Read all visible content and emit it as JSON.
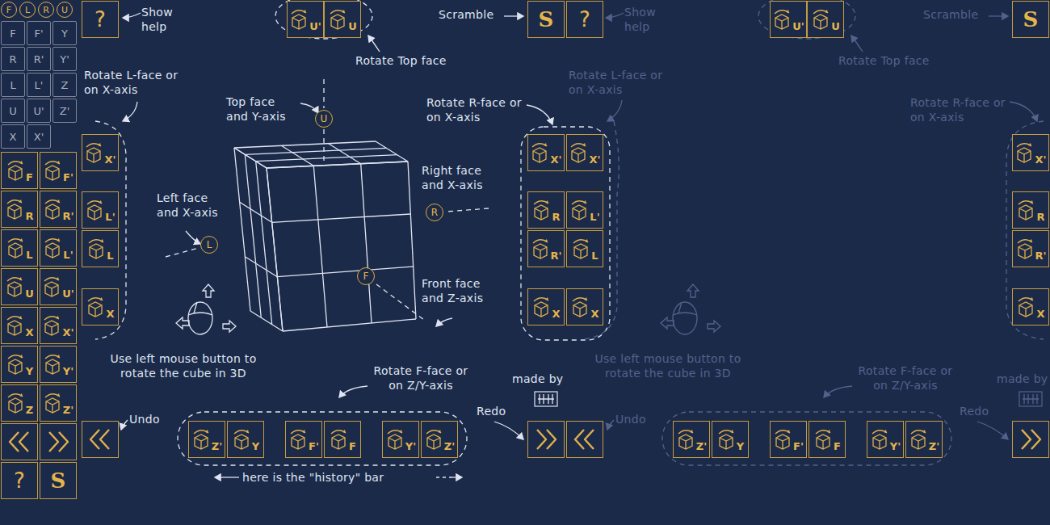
{
  "sidebar": {
    "face_toggles": [
      "F",
      "L",
      "R",
      "U"
    ],
    "small_buttons": [
      {
        "label": "F",
        "disabled": true
      },
      {
        "label": "F'",
        "disabled": true
      },
      {
        "label": "Y",
        "disabled": true
      },
      {
        "label": "R",
        "disabled": true
      },
      {
        "label": "R'",
        "disabled": true
      },
      {
        "label": "Y'",
        "disabled": true
      },
      {
        "label": "L",
        "disabled": true
      },
      {
        "label": "L'",
        "disabled": true
      },
      {
        "label": "Z",
        "disabled": true
      },
      {
        "label": "U",
        "disabled": true
      },
      {
        "label": "U'",
        "disabled": true
      },
      {
        "label": "Z'",
        "disabled": true
      },
      {
        "label": "X",
        "disabled": true
      },
      {
        "label": "X'",
        "disabled": true
      }
    ],
    "buttons": [
      {
        "kind": "move",
        "label": "F"
      },
      {
        "kind": "move",
        "label": "F'"
      },
      {
        "kind": "move",
        "label": "R"
      },
      {
        "kind": "move",
        "label": "R'"
      },
      {
        "kind": "move",
        "label": "L"
      },
      {
        "kind": "move",
        "label": "L'"
      },
      {
        "kind": "move",
        "label": "U"
      },
      {
        "kind": "move",
        "label": "U'"
      },
      {
        "kind": "move",
        "label": "X"
      },
      {
        "kind": "move",
        "label": "X'"
      },
      {
        "kind": "move",
        "label": "Y"
      },
      {
        "kind": "move",
        "label": "Y'"
      },
      {
        "kind": "move",
        "label": "Z"
      },
      {
        "kind": "move",
        "label": "Z'"
      },
      {
        "kind": "undo"
      },
      {
        "kind": "redo"
      },
      {
        "kind": "help",
        "label": "?"
      },
      {
        "kind": "scramble",
        "label": "S"
      }
    ]
  },
  "help_overlay": {
    "notes": [
      {
        "text": "Show help",
        "faded": false
      },
      {
        "text": "Scramble",
        "faded": false
      },
      {
        "text": "Rotate Top face",
        "faded": false
      },
      {
        "text": "Rotate L-face or on X-axis",
        "faded": false
      },
      {
        "text": "Top face and Y-axis",
        "faded": false
      },
      {
        "text": "Rotate R-face or on X-axis",
        "faded": false
      },
      {
        "text": "Right face and X-axis",
        "faded": false
      },
      {
        "text": "Left face and X-axis",
        "faded": false
      },
      {
        "text": "Front face and Z-axis",
        "faded": false
      },
      {
        "text": "Use left mouse button to rotate the cube in 3D",
        "faded": false
      },
      {
        "text": "Rotate F-face or on Z/Y-axis",
        "faded": false
      },
      {
        "text": "made by",
        "faded": false
      },
      {
        "text": "Undo",
        "faded": false
      },
      {
        "text": "Redo",
        "faded": false
      },
      {
        "text": "here is the \"history\" bar",
        "faded": false
      },
      {
        "text": "Show help",
        "faded": true
      },
      {
        "text": "Scramble",
        "faded": true
      },
      {
        "text": "Rotate Top face",
        "faded": true
      },
      {
        "text": "Rotate L-face or on X-axis",
        "faded": true
      },
      {
        "text": "Rotate R-face or on X-axis",
        "faded": true
      },
      {
        "text": "Use left mouse button to rotate the cube in 3D",
        "faded": true
      },
      {
        "text": "Rotate F-face or on Z/Y-axis",
        "faded": true
      },
      {
        "text": "made by",
        "faded": true
      },
      {
        "text": "Undo",
        "faded": true
      },
      {
        "text": "Redo",
        "faded": true
      }
    ],
    "buttons": [
      {
        "kind": "help",
        "label": "?"
      },
      {
        "kind": "move",
        "label": "U'"
      },
      {
        "kind": "move",
        "label": "U"
      },
      {
        "kind": "scramble",
        "label": "S"
      },
      {
        "kind": "help",
        "label": "?"
      },
      {
        "kind": "move",
        "label": "U'"
      },
      {
        "kind": "move",
        "label": "U"
      },
      {
        "kind": "scramble",
        "label": "S"
      },
      {
        "kind": "move",
        "label": "X'"
      },
      {
        "kind": "move",
        "label": "L'"
      },
      {
        "kind": "move",
        "label": "L"
      },
      {
        "kind": "move",
        "label": "X"
      },
      {
        "kind": "move",
        "label": "X'"
      },
      {
        "kind": "move",
        "label": "X'"
      },
      {
        "kind": "move",
        "label": "R"
      },
      {
        "kind": "move",
        "label": "L'"
      },
      {
        "kind": "move",
        "label": "R'"
      },
      {
        "kind": "move",
        "label": "L"
      },
      {
        "kind": "move",
        "label": "X"
      },
      {
        "kind": "move",
        "label": "X"
      },
      {
        "kind": "move",
        "label": "X'"
      },
      {
        "kind": "move",
        "label": "R"
      },
      {
        "kind": "move",
        "label": "R'"
      },
      {
        "kind": "move",
        "label": "X"
      },
      {
        "kind": "undo"
      },
      {
        "kind": "move",
        "label": "Z'"
      },
      {
        "kind": "move",
        "label": "Y"
      },
      {
        "kind": "move",
        "label": "F'"
      },
      {
        "kind": "move",
        "label": "F"
      },
      {
        "kind": "move",
        "label": "Y'"
      },
      {
        "kind": "move",
        "label": "Z'"
      },
      {
        "kind": "redo"
      },
      {
        "kind": "undo"
      },
      {
        "kind": "move",
        "label": "Z'"
      },
      {
        "kind": "move",
        "label": "Y"
      },
      {
        "kind": "move",
        "label": "F'"
      },
      {
        "kind": "move",
        "label": "F"
      },
      {
        "kind": "move",
        "label": "Y'"
      },
      {
        "kind": "move",
        "label": "Z'"
      },
      {
        "kind": "redo"
      }
    ],
    "axis_markers": [
      "U",
      "R",
      "L",
      "F"
    ]
  }
}
